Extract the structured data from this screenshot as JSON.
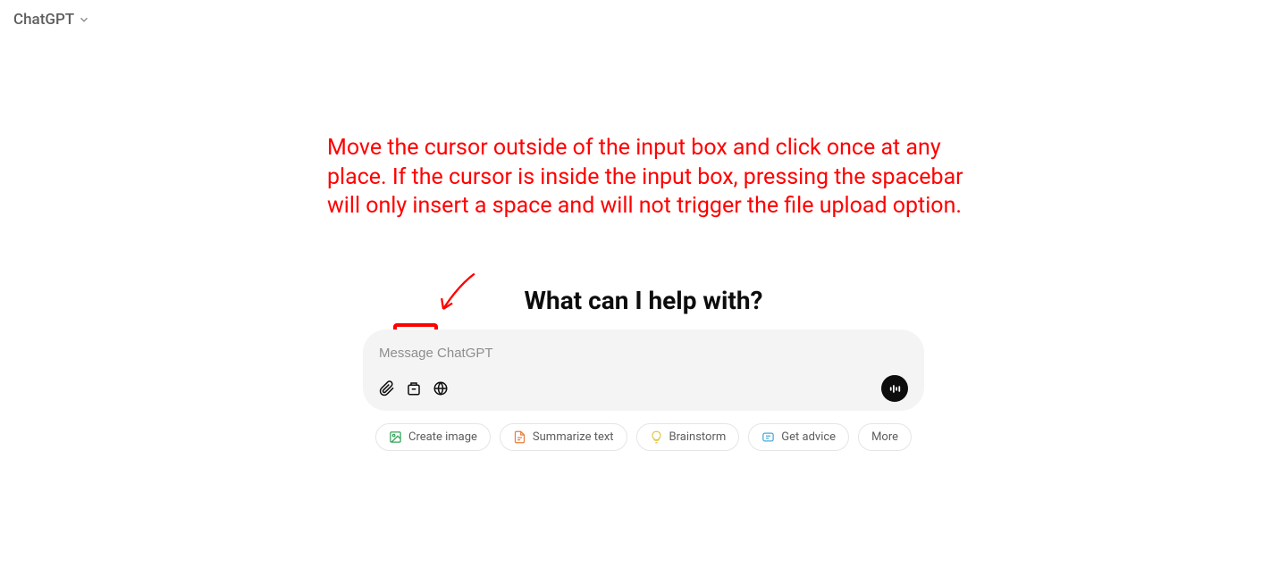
{
  "header": {
    "model_label": "ChatGPT"
  },
  "annotation": {
    "text": "Move the cursor outside of the input box and click once at any place. If the cursor is inside the input box, pressing the spacebar will only insert a space and will not trigger the file upload option."
  },
  "main": {
    "heading": "What can I help with?",
    "input_placeholder": "Message ChatGPT"
  },
  "suggestions": {
    "create_image": "Create image",
    "summarize_text": "Summarize text",
    "brainstorm": "Brainstorm",
    "get_advice": "Get advice",
    "more": "More"
  }
}
